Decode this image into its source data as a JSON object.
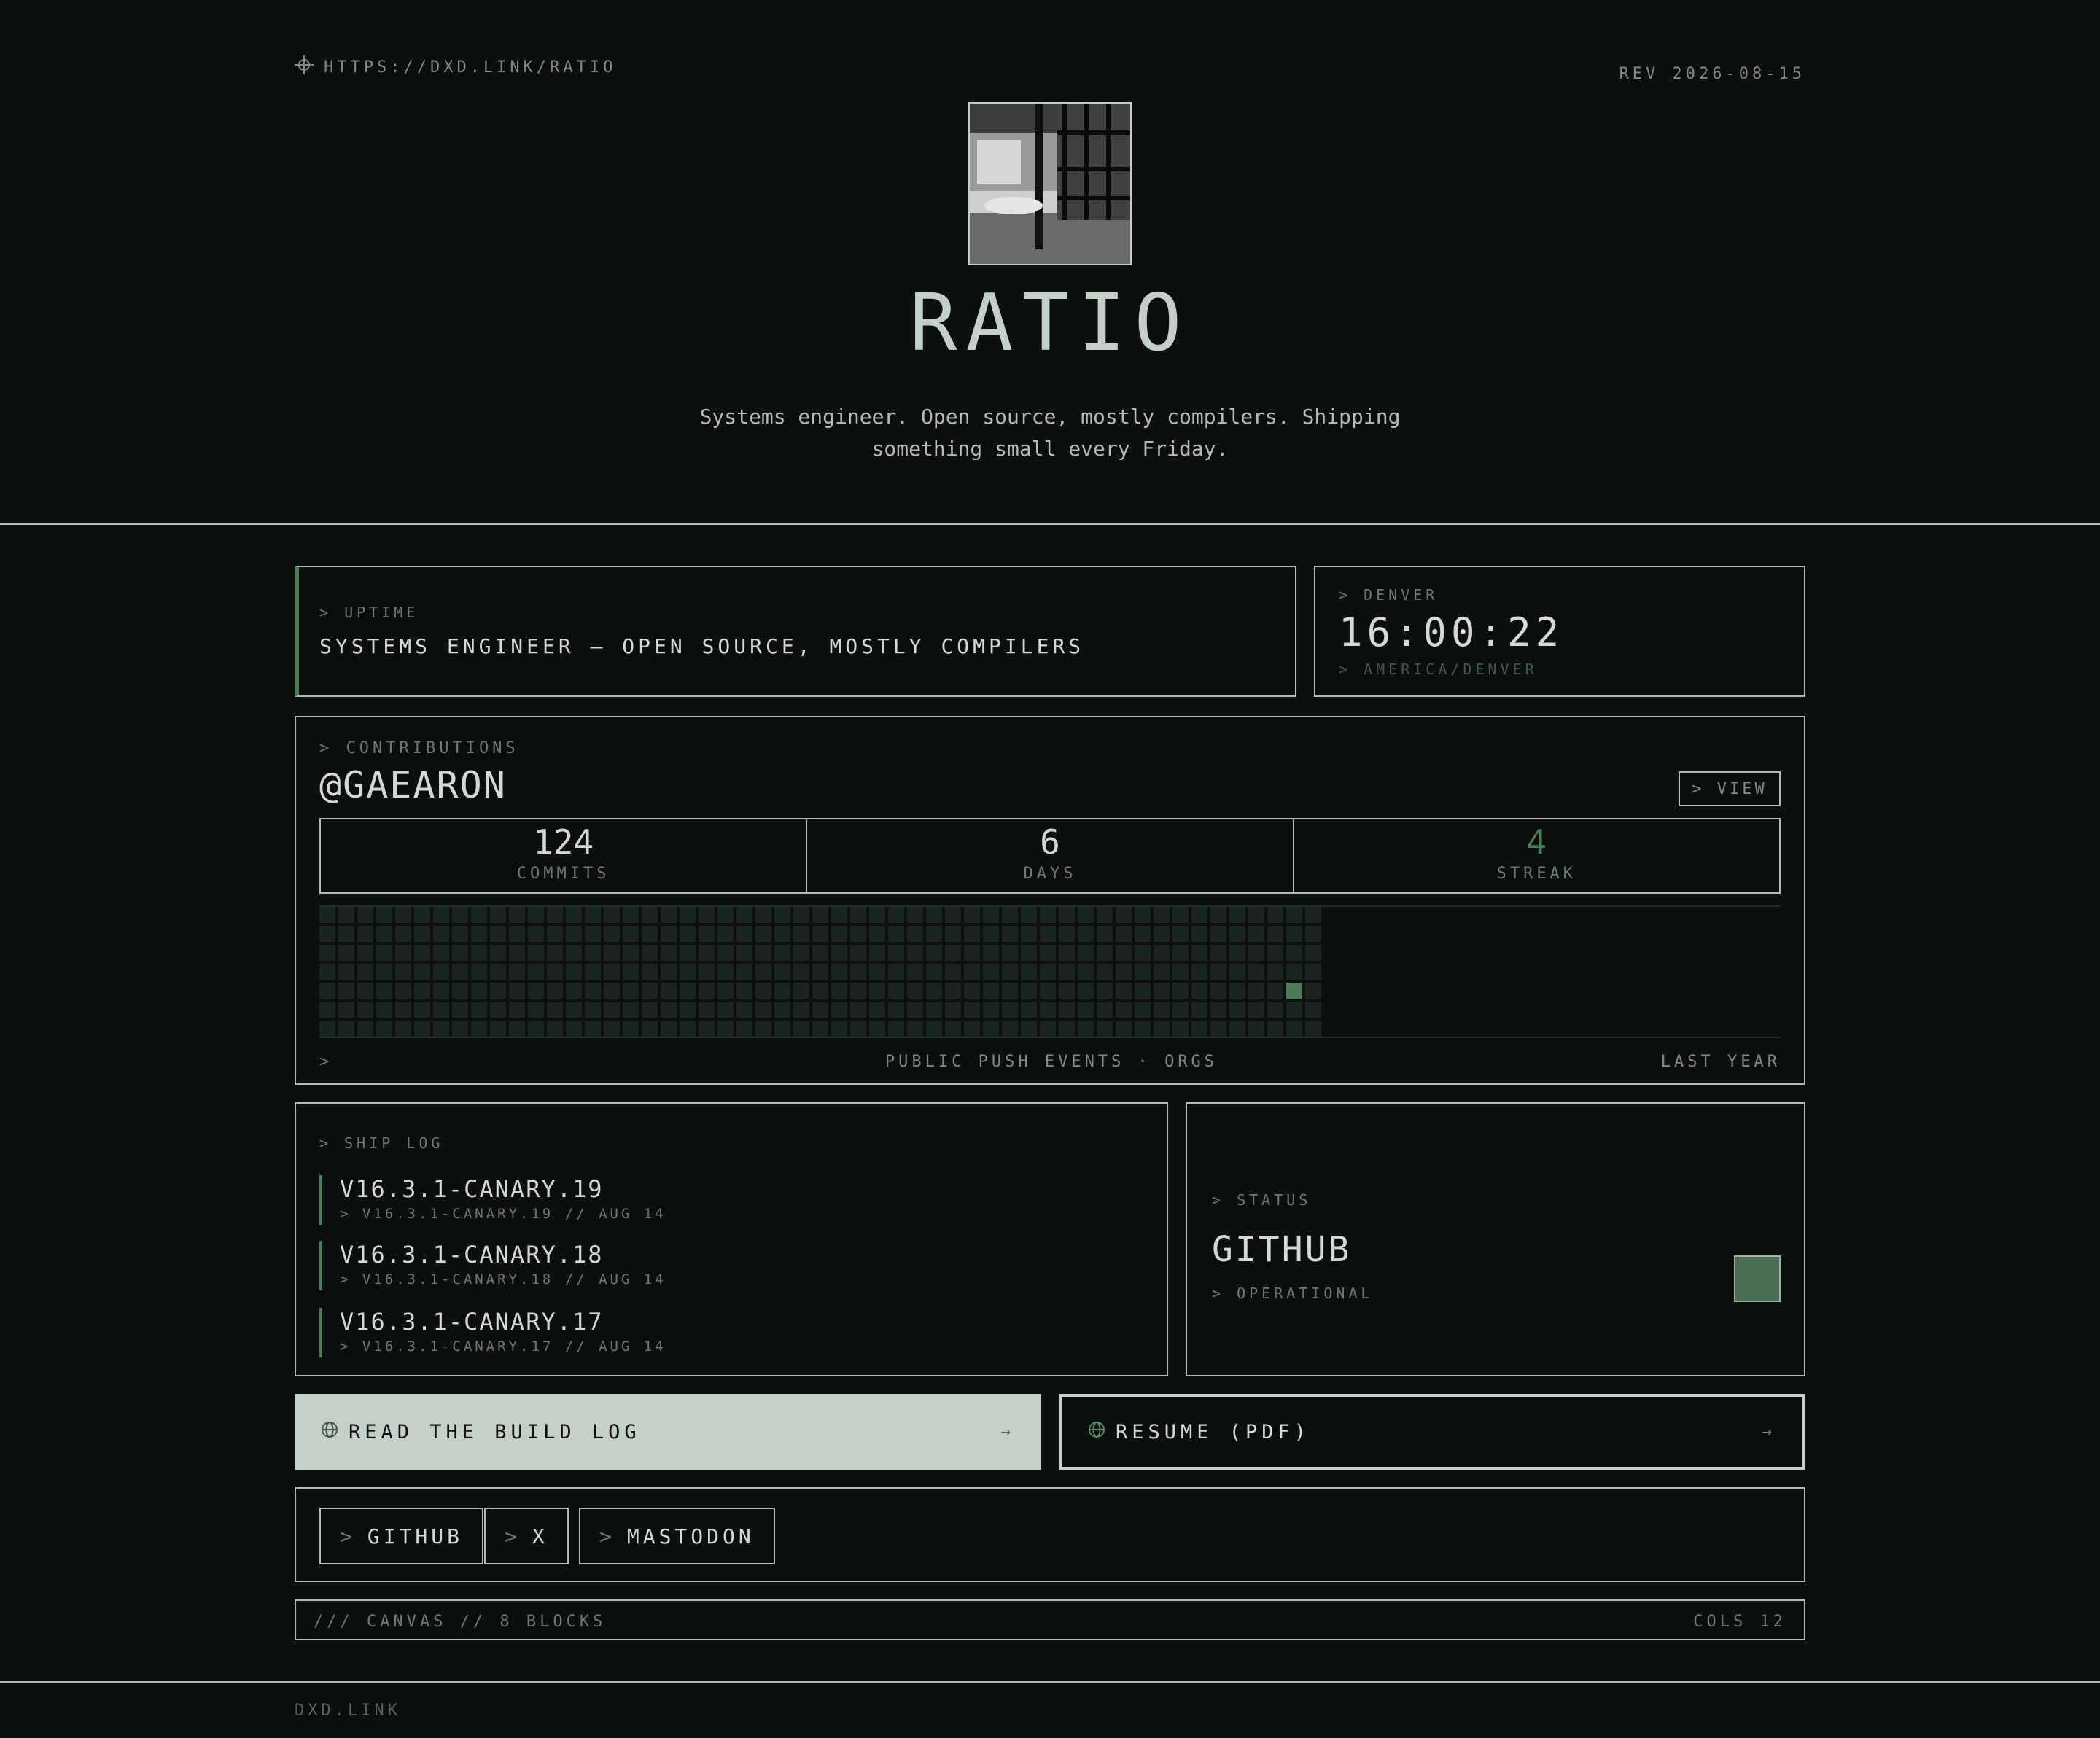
{
  "header": {
    "url": "HTTPS://DXD.LINK/RATIO",
    "revision": "REV 2026-08-15",
    "title": "RATIO",
    "bio": "Systems engineer. Open source, mostly compilers. Shipping something small every Friday."
  },
  "uptime": {
    "caption": "> UPTIME",
    "value": "SYSTEMS ENGINEER — OPEN SOURCE, MOSTLY COMPILERS"
  },
  "clock": {
    "caption": "> DENVER",
    "time": "16:00:22",
    "timezone": "> AMERICA/DENVER"
  },
  "contributions": {
    "caption": "> CONTRIBUTIONS",
    "user": "@GAEARON",
    "view_label": "> VIEW",
    "stats": [
      {
        "value": "124",
        "label": "COMMITS"
      },
      {
        "value": "6",
        "label": "DAYS"
      },
      {
        "value": "4",
        "label": "STREAK"
      }
    ],
    "heatmap": {
      "weeks": 53,
      "days": 7,
      "active": [
        {
          "week": 51,
          "day": 4,
          "level": 1
        }
      ]
    },
    "footer_prompt": ">",
    "footer_center": "PUBLIC PUSH EVENTS · ORGS",
    "footer_right": "LAST YEAR"
  },
  "shiplog": {
    "caption": "> SHIP LOG",
    "entries": [
      {
        "title": "V16.3.1-CANARY.19",
        "sub": "> V16.3.1-CANARY.19 // AUG 14"
      },
      {
        "title": "V16.3.1-CANARY.18",
        "sub": "> V16.3.1-CANARY.18 // AUG 14"
      },
      {
        "title": "V16.3.1-CANARY.17",
        "sub": "> V16.3.1-CANARY.17 // AUG 14"
      }
    ]
  },
  "status": {
    "caption": "> STATUS",
    "name": "GITHUB",
    "state": "> OPERATIONAL"
  },
  "actions": {
    "build_log": "READ THE BUILD LOG",
    "resume": "RESUME (PDF)",
    "arrow": "→"
  },
  "social": {
    "prompt": ">",
    "links": [
      "GITHUB",
      "X",
      "MASTODON"
    ]
  },
  "canvas": {
    "left": "/// CANVAS // 8 BLOCKS",
    "right": "COLS 12"
  },
  "footer": {
    "domain": "DXD.LINK"
  },
  "colors": {
    "accent": "#4e7a5c",
    "background": "#0b0f0e",
    "foreground": "#c5cfc7"
  }
}
